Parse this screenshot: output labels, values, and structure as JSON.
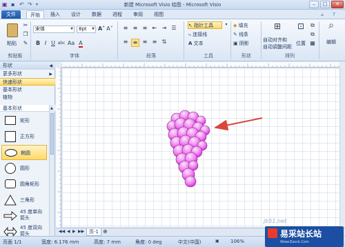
{
  "window": {
    "title": "新建 Microsoft Visio 绘图 - Microsoft Visio",
    "minimize": "–",
    "maximize": "□",
    "close": "✕"
  },
  "tabs": [
    "文件",
    "开始",
    "插入",
    "设计",
    "数据",
    "进程",
    "审阅",
    "视图"
  ],
  "ribbon": {
    "clipboard": {
      "paste": "粘贴",
      "label": "剪贴板"
    },
    "font": {
      "name": "宋体",
      "size": "8pt",
      "label": "字体"
    },
    "paragraph": {
      "label": "段落"
    },
    "tools": {
      "pointer": "指针工具",
      "connector": "连接线",
      "text": "文本",
      "label": "工具"
    },
    "shape": {
      "fill": "填充",
      "line": "线条",
      "shadow": "阴影",
      "label": "形状"
    },
    "arrange": {
      "auto_align": "自动对齐和",
      "auto_space": "自动调整间距",
      "position": "位置",
      "label": "排列"
    },
    "editing": {
      "label": "编辑"
    }
  },
  "shapes_pane": {
    "header": "形状",
    "more_shapes": "更多形状",
    "quick_shapes": "快速形状",
    "basic_shapes": "基本形状",
    "plants": "植物",
    "stencil_title": "基本形状",
    "items": [
      {
        "label": "矩形"
      },
      {
        "label": "正方形"
      },
      {
        "label": "椭圆"
      },
      {
        "label": "圆形"
      },
      {
        "label": "圆角矩形"
      },
      {
        "label": "三角形"
      },
      {
        "label": "45 度单向箭头"
      },
      {
        "label": "45 度双向箭头"
      }
    ]
  },
  "page_tab": "页-1",
  "status": {
    "page": "页面 1/1",
    "width": "宽度: 6.176 mm",
    "height": "高度: 7 mm",
    "angle": "角度: 0 deg",
    "language": "中文(中国)",
    "zoom": "106%"
  },
  "watermark": {
    "site": "jb51.net",
    "brand": "易采站长站",
    "url": "Www.Easck.Com"
  },
  "colors": {
    "grape": "#e838e8",
    "arrow": "#d9463a",
    "accent": "#2b5797"
  }
}
